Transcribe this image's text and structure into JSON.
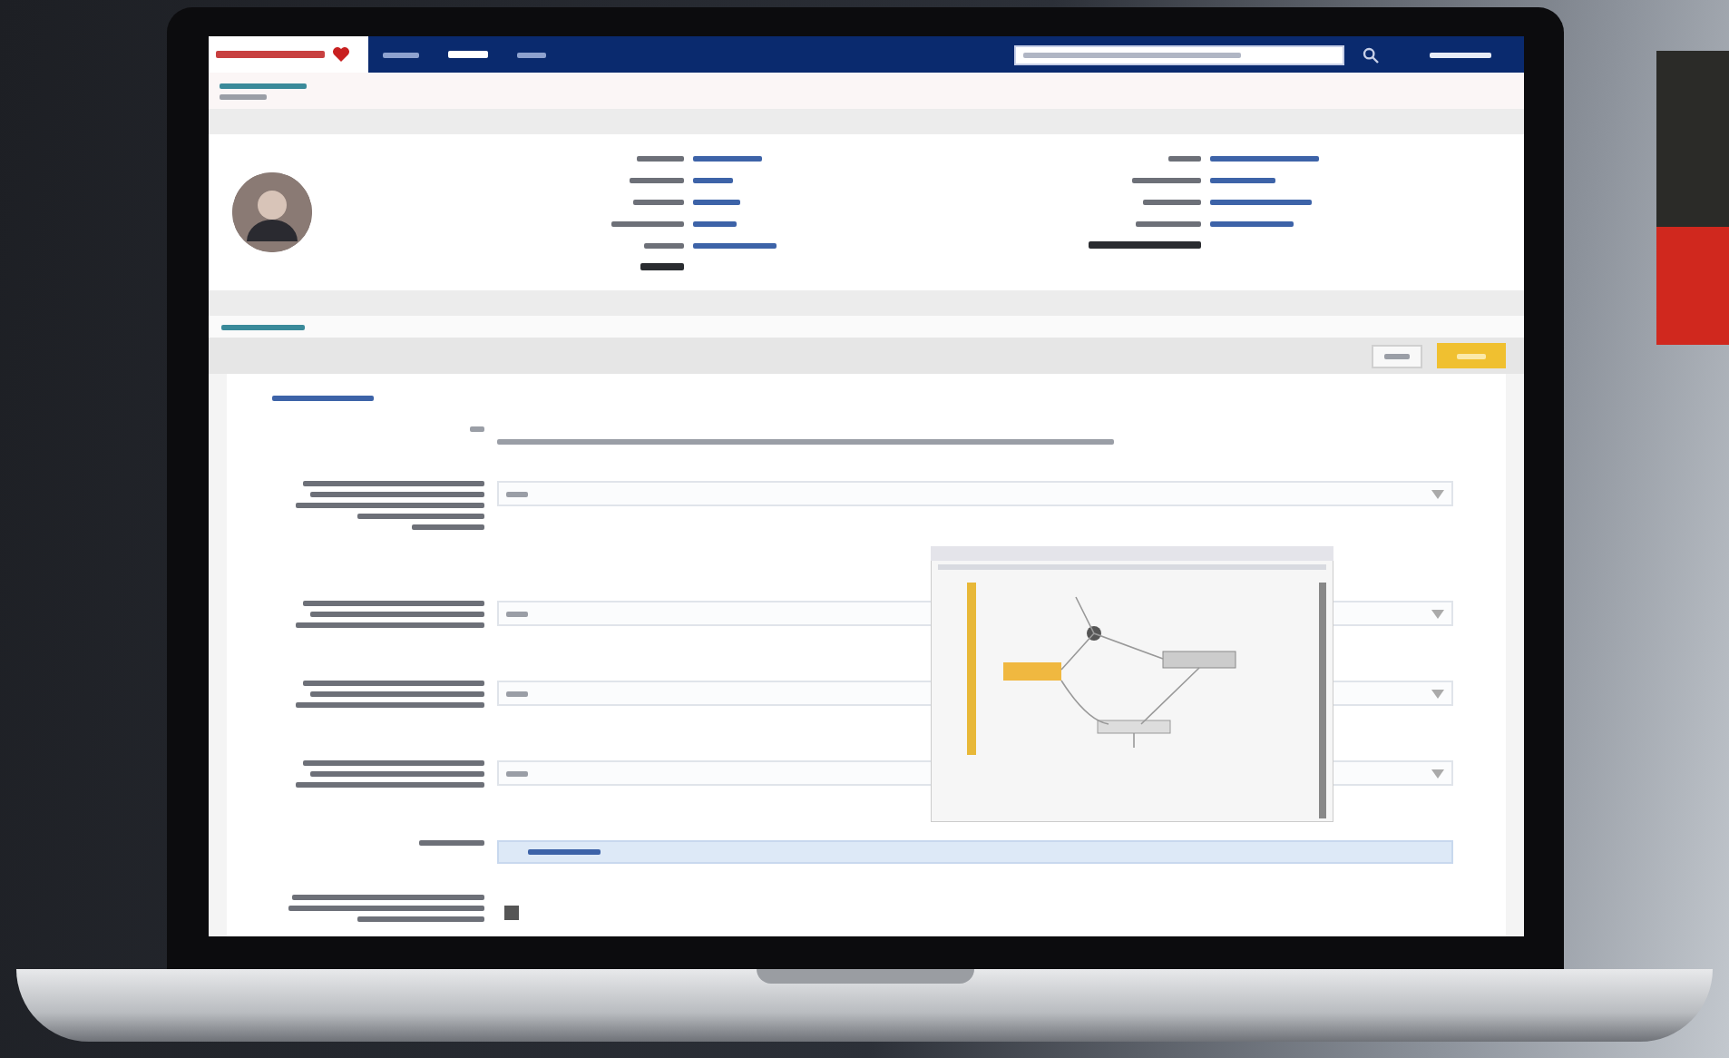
{
  "nav": {
    "tabs": [
      {
        "selected": false
      },
      {
        "selected": true
      },
      {
        "selected": false
      }
    ]
  },
  "profile": {
    "left_fields": [
      {
        "value_shown": true
      },
      {
        "value_shown": true
      },
      {
        "value_shown": true
      },
      {
        "value_shown": true
      },
      {
        "value_shown": true
      },
      {
        "value_shown": false
      }
    ],
    "right_fields": [
      {
        "value_shown": true
      },
      {
        "value_shown": true
      },
      {
        "value_shown": true
      },
      {
        "value_shown": true
      },
      {
        "value_shown": false
      }
    ]
  },
  "form_rows": [
    {
      "kind": "note"
    },
    {
      "kind": "dropdown"
    },
    {
      "kind": "dropdown"
    },
    {
      "kind": "dropdown"
    },
    {
      "kind": "dropdown"
    },
    {
      "kind": "attachment"
    },
    {
      "kind": "checkbox",
      "checked": true
    }
  ]
}
